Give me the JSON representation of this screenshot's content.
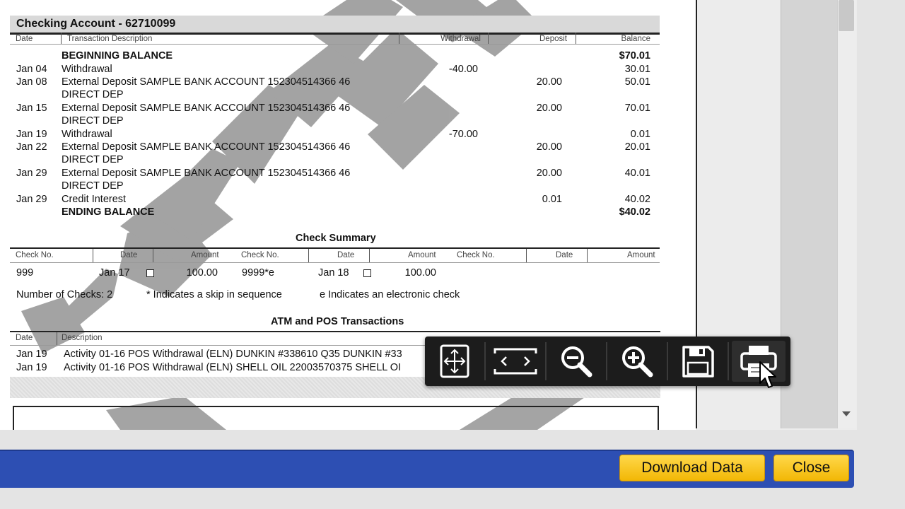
{
  "statement": {
    "title": "Checking Account - 62710099",
    "columns": {
      "date": "Date",
      "description": "Transaction Description",
      "withdrawal": "Withdrawal",
      "deposit": "Deposit",
      "balance": "Balance"
    },
    "beginning_label": "BEGINNING BALANCE",
    "beginning_balance": "$70.01",
    "transactions": [
      {
        "date": "Jan 04",
        "desc": "Withdrawal",
        "withdrawal": "-40.00",
        "deposit": "",
        "balance": "30.01"
      },
      {
        "date": "Jan 08",
        "desc": "External Deposit SAMPLE BANK ACCOUNT 152304514366 46",
        "desc2": "DIRECT DEP",
        "withdrawal": "",
        "deposit": "20.00",
        "balance": "50.01"
      },
      {
        "date": "Jan 15",
        "desc": "External Deposit SAMPLE BANK ACCOUNT 152304514366 46",
        "desc2": "DIRECT DEP",
        "withdrawal": "",
        "deposit": "20.00",
        "balance": "70.01"
      },
      {
        "date": "Jan 19",
        "desc": "Withdrawal",
        "withdrawal": "-70.00",
        "deposit": "",
        "balance": "0.01"
      },
      {
        "date": "Jan 22",
        "desc": "External Deposit SAMPLE BANK ACCOUNT 152304514366 46",
        "desc2": "DIRECT DEP",
        "withdrawal": "",
        "deposit": "20.00",
        "balance": "20.01"
      },
      {
        "date": "Jan 29",
        "desc": "External Deposit SAMPLE BANK ACCOUNT 152304514366 46",
        "desc2": "DIRECT DEP",
        "withdrawal": "",
        "deposit": "20.00",
        "balance": "40.01"
      },
      {
        "date": "Jan 29",
        "desc": "Credit Interest",
        "withdrawal": "",
        "deposit": "0.01",
        "balance": "40.02"
      }
    ],
    "ending_label": "ENDING BALANCE",
    "ending_balance": "$40.02"
  },
  "check_summary": {
    "title": "Check Summary",
    "columns": [
      "Check No.",
      "Date",
      "Amount",
      "Check No.",
      "Date",
      "Amount",
      "Check No.",
      "Date",
      "Amount"
    ],
    "rows": [
      {
        "check1": "999",
        "date1": "Jan 17",
        "amount1": "100.00",
        "check2": "9999*e",
        "date2": "Jan 18",
        "amount2": "100.00"
      }
    ],
    "count_note": "Number of Checks: 2",
    "skip_note": "* Indicates a skip in sequence",
    "electronic_note": "e Indicates an electronic check"
  },
  "atm_pos": {
    "title": "ATM and POS Transactions",
    "columns": {
      "date": "Date",
      "description": "Description"
    },
    "rows": [
      {
        "date": "Jan 19",
        "desc": "Activity 01-16 POS Withdrawal (ELN) DUNKIN #338610 Q35 DUNKIN #33"
      },
      {
        "date": "Jan 19",
        "desc": "Activity 01-16 POS Withdrawal (ELN) SHELL OIL 22003570375 SHELL OI"
      }
    ]
  },
  "watermark_text": "SAMPLE",
  "toolbar": {
    "buttons": [
      {
        "name": "fit-page",
        "icon": "fit-page-icon"
      },
      {
        "name": "fit-width",
        "icon": "fit-width-icon"
      },
      {
        "name": "zoom-out",
        "icon": "zoom-out-icon"
      },
      {
        "name": "zoom-in",
        "icon": "zoom-in-icon"
      },
      {
        "name": "save",
        "icon": "floppy-disk-icon"
      },
      {
        "name": "print",
        "icon": "printer-icon"
      }
    ]
  },
  "footer": {
    "download_label": "Download Data",
    "close_label": "Close"
  },
  "colors": {
    "footer_bar": "#2d4fb3",
    "button_yellow": "#f2b705",
    "toolbar_bg": "#1c1c1c",
    "icon_white": "#ffffff"
  }
}
